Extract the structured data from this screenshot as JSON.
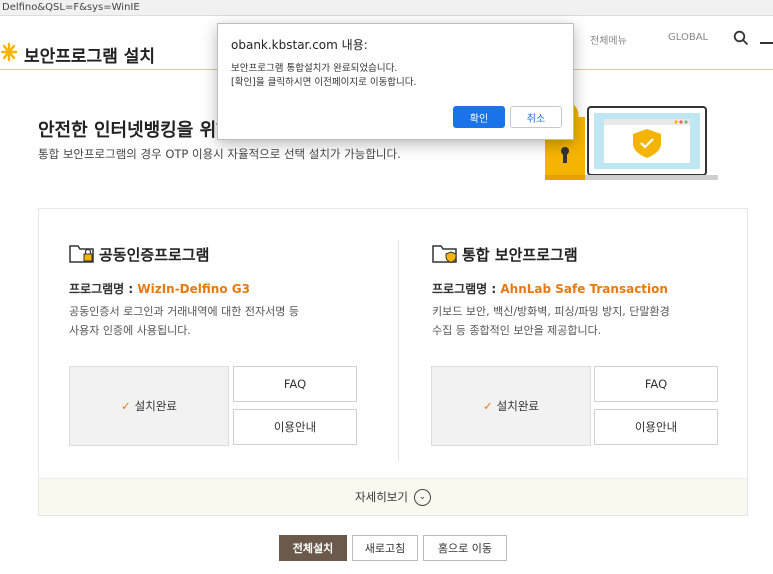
{
  "browser": {
    "url": "Delfino&QSL=F&sys=WinIE"
  },
  "header": {
    "title": "보안프로그램 설치",
    "nav_text": "전체메뉴",
    "global_text": "GLOBAL"
  },
  "hero": {
    "title": "안전한 인터넷뱅킹을 위해",
    "description": "통합 보안프로그램의 경우 OTP 이용시 자율적으로 선택 설치가 가능합니다."
  },
  "left": {
    "title": "공동인증프로그램",
    "name_label": "프로그램명 : ",
    "name_value": "WizIn-Delfino G3",
    "desc_line1": "공동인증서 로그인과 거래내역에 대한 전자서명 등",
    "desc_line2": "사용자 인증에 사용됩니다.",
    "status": "설치완료",
    "faq": "FAQ",
    "guide": "이용안내"
  },
  "right": {
    "title": "통합 보안프로그램",
    "name_label": "프로그램명 : ",
    "name_value": "AhnLab Safe Transaction",
    "desc_line1": "키보드 보안, 백신/방화벽, 피싱/파밍 방지, 단말환경",
    "desc_line2": "수집 등 종합적인 보안을 제공합니다.",
    "status": "설치완료",
    "faq": "FAQ",
    "guide": "이용안내"
  },
  "detail": {
    "label": "자세히보기"
  },
  "bottom": {
    "install_all": "전체설치",
    "refresh": "새로고침",
    "home": "홈으로 이동"
  },
  "dialog": {
    "title": "obank.kbstar.com 내용:",
    "line1": "보안프로그램 통합설치가 완료되었습니다.",
    "line2": "[확인]을 클릭하시면 이전페이지로 이동합니다.",
    "ok": "확인",
    "cancel": "취소"
  },
  "colors": {
    "accent": "#e8790e",
    "primary_button": "#6b5a4b",
    "dialog_ok": "#1a73e8",
    "brand_yellow": "#f5b400"
  }
}
